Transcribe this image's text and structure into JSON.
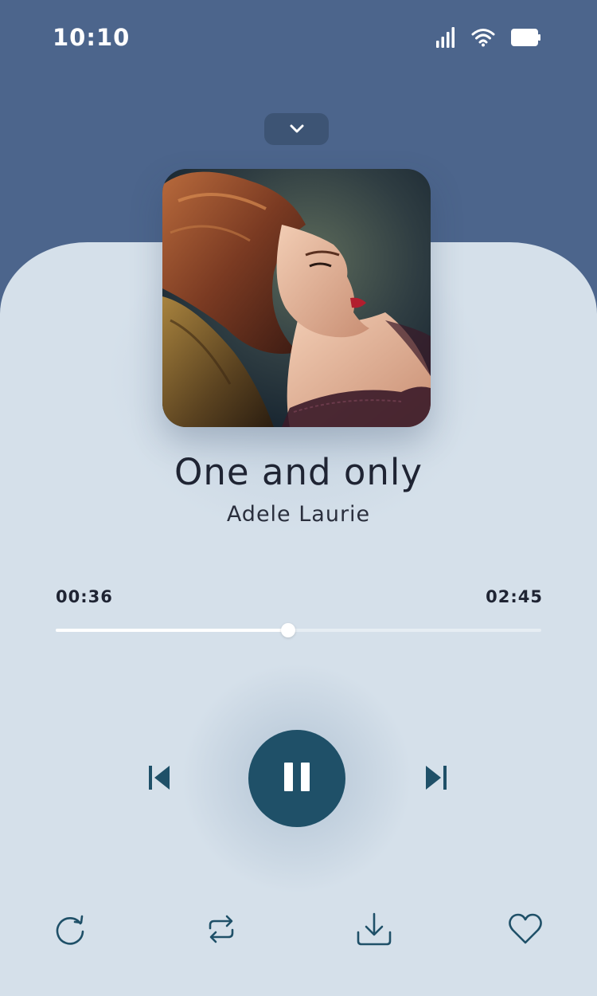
{
  "status_bar": {
    "time": "10:10",
    "icons": [
      "cellular-signal-icon",
      "wifi-icon",
      "battery-icon"
    ]
  },
  "header": {
    "collapse_icon": "chevron-down-icon"
  },
  "track": {
    "title": "One and only",
    "artist": "Adele Laurie",
    "album_art": "album-cover-image"
  },
  "playback": {
    "elapsed": "00:36",
    "duration": "02:45",
    "progress_fraction": 0.478,
    "state": "playing"
  },
  "controls": {
    "previous_icon": "skip-previous-icon",
    "play_pause_icon": "pause-icon",
    "next_icon": "skip-next-icon"
  },
  "bottom_actions": [
    "replay-icon",
    "repeat-icon",
    "download-icon",
    "heart-icon"
  ],
  "colors": {
    "header_bg": "#4c658c",
    "panel_bg": "#d5e0ea",
    "accent": "#1f5068",
    "text": "#1f2433"
  }
}
